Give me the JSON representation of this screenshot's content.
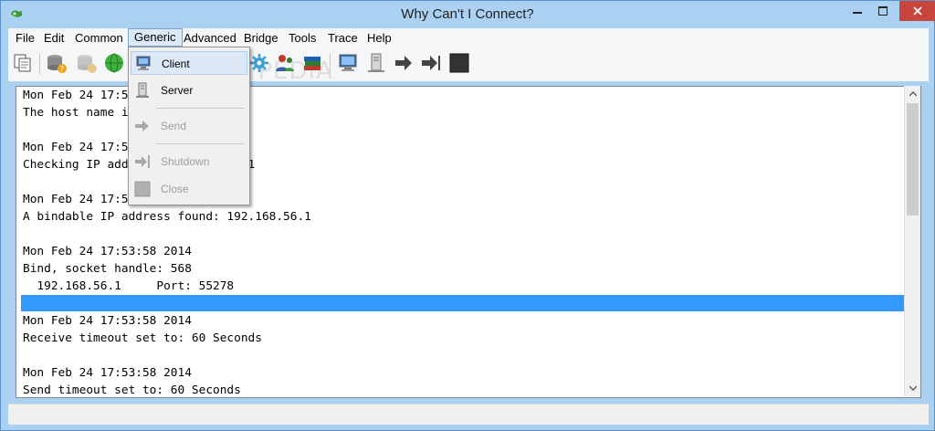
{
  "window": {
    "title": "Why Can't I Connect?",
    "accent_color": "#aad1f2",
    "close_color": "#c7453d"
  },
  "menubar": {
    "items": [
      {
        "label": "File"
      },
      {
        "label": "Edit"
      },
      {
        "label": "Common"
      },
      {
        "label": "Generic",
        "active": true
      },
      {
        "label": "Advanced"
      },
      {
        "label": "Bridge"
      },
      {
        "label": "Tools"
      },
      {
        "label": "Trace"
      },
      {
        "label": "Help"
      }
    ]
  },
  "toolbar": {
    "icons": [
      "copy-icon",
      "database-help-icon",
      "database-help-disabled-icon",
      "globe-icon",
      "network-gear-icon",
      "users-icon",
      "books-icon",
      "client-computer-icon",
      "server-tower-icon",
      "send-arrow-icon",
      "shutdown-arrow-icon",
      "stop-icon"
    ]
  },
  "generic_menu": {
    "items": [
      {
        "label": "Client",
        "icon": "client-computer-icon",
        "enabled": true
      },
      {
        "label": "Server",
        "icon": "server-tower-icon",
        "enabled": true
      },
      {
        "label": "Send",
        "icon": "send-arrow-icon",
        "enabled": false
      },
      {
        "label": "Shutdown",
        "icon": "shutdown-arrow-icon",
        "enabled": false
      },
      {
        "label": "Close",
        "icon": "close-square-icon",
        "enabled": false
      }
    ]
  },
  "log": {
    "lines": [
      "Mon Feb 24 17:53:58 2014",
      "The host name is: SOFTPEDIA-S74",
      "",
      "Mon Feb 24 17:53:58 2014",
      "Checking IP address: 192.168.56.1",
      "",
      "Mon Feb 24 17:53:58 2014",
      "A bindable IP address found: 192.168.56.1",
      "",
      "Mon Feb 24 17:53:58 2014",
      "Bind, socket handle: 568",
      "  192.168.56.1     Port: 55278",
      "",
      "Mon Feb 24 17:53:58 2014",
      "Receive timeout set to: 60 Seconds",
      "",
      "Mon Feb 24 17:53:58 2014",
      "Send timeout set to: 60 Seconds"
    ],
    "highlight_color": "#3399ff"
  },
  "watermark": "SOFTPEDIA"
}
